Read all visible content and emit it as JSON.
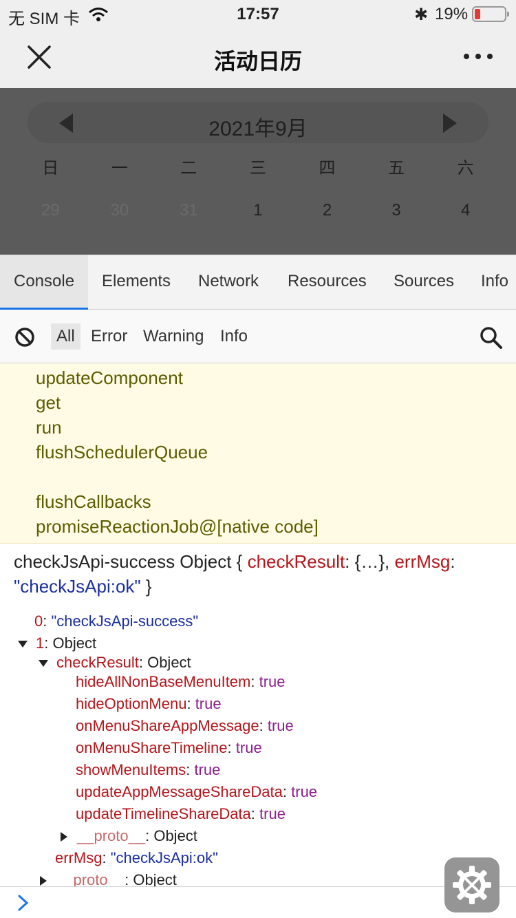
{
  "status_bar": {
    "carrier": "无 SIM 卡",
    "time": "17:57",
    "battery_percent": "19%",
    "battery_level": 0.19,
    "wifi_icon": "wifi-icon",
    "bluetooth_icon": "bluetooth-icon"
  },
  "nav": {
    "title": "活动日历",
    "close_icon": "close-icon",
    "more_icon": "more-icon"
  },
  "calendar": {
    "month_label": "2021年9月",
    "weekdays": [
      "日",
      "一",
      "二",
      "三",
      "四",
      "五",
      "六"
    ],
    "days": [
      {
        "label": "29",
        "other_month": true
      },
      {
        "label": "30",
        "other_month": true
      },
      {
        "label": "31",
        "other_month": true
      },
      {
        "label": "1",
        "other_month": false
      },
      {
        "label": "2",
        "other_month": false
      },
      {
        "label": "3",
        "other_month": false
      },
      {
        "label": "4",
        "other_month": false
      }
    ]
  },
  "devtools": {
    "tabs": [
      "Console",
      "Elements",
      "Network",
      "Resources",
      "Sources",
      "Info"
    ],
    "active_tab": "Console",
    "filters": [
      "All",
      "Error",
      "Warning",
      "Info"
    ],
    "active_filter": "All"
  },
  "warning_stack": [
    "updateComponent",
    "get",
    "run",
    "flushSchedulerQueue",
    "",
    "flushCallbacks",
    "promiseReactionJob@[native code]"
  ],
  "log": {
    "summary": {
      "prefix": "checkJsApi-success Object { ",
      "key1": "checkResult",
      "mid1": ": {…}, ",
      "key2": "errMsg",
      "mid2": ": ",
      "value2": "\"checkJsApi:ok\"",
      "suffix": " }"
    },
    "item0": {
      "key": "0",
      "value": "\"checkJsApi-success\""
    },
    "item1": {
      "key": "1",
      "value": "Object"
    },
    "checkResult": {
      "key": "checkResult",
      "value": "Object"
    },
    "props": [
      {
        "key": "hideAllNonBaseMenuItem",
        "value": "true"
      },
      {
        "key": "hideOptionMenu",
        "value": "true"
      },
      {
        "key": "onMenuShareAppMessage",
        "value": "true"
      },
      {
        "key": "onMenuShareTimeline",
        "value": "true"
      },
      {
        "key": "showMenuItems",
        "value": "true"
      },
      {
        "key": "updateAppMessageShareData",
        "value": "true"
      },
      {
        "key": "updateTimelineShareData",
        "value": "true"
      }
    ],
    "proto_inner": {
      "key": "__proto__",
      "value": "Object"
    },
    "errMsg": {
      "key": "errMsg",
      "value": "\"checkJsApi:ok\""
    },
    "proto_outer": {
      "key": "__proto__",
      "value": "Object"
    }
  },
  "colors": {
    "key": "#b3161b",
    "string": "#1a2fa0",
    "boolean": "#8b1f8b",
    "active_tab_underline": "#1a73e8",
    "warning_bg": "#fffbe5"
  }
}
